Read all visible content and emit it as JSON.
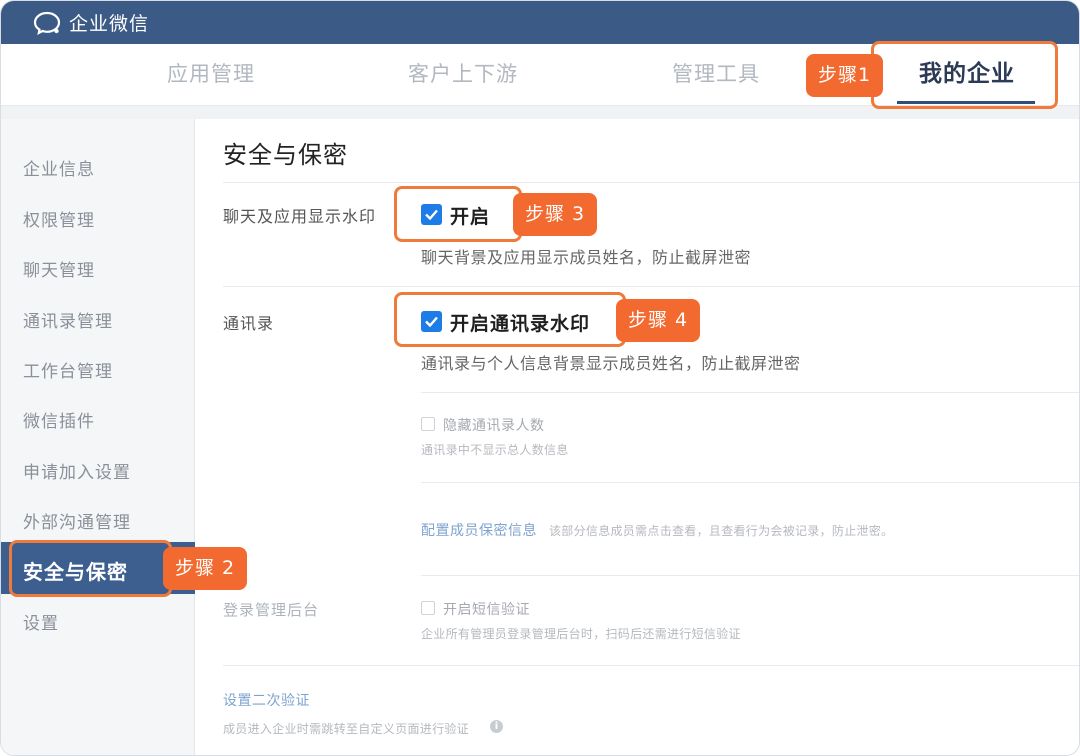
{
  "app": {
    "title": "企业微信",
    "logo_icon": "wecom-chat-bubble-icon"
  },
  "nav": {
    "tabs": [
      {
        "label": "应用管理"
      },
      {
        "label": "客户上下游"
      },
      {
        "label": "管理工具"
      },
      {
        "label": "我的企业"
      }
    ],
    "active_tab": "我的企业"
  },
  "sidebar": {
    "items": [
      {
        "label": "企业信息"
      },
      {
        "label": "权限管理"
      },
      {
        "label": "聊天管理"
      },
      {
        "label": "通讯录管理"
      },
      {
        "label": "工作台管理"
      },
      {
        "label": "微信插件"
      },
      {
        "label": "申请加入设置"
      },
      {
        "label": "外部沟通管理"
      },
      {
        "label": "安全与保密"
      },
      {
        "label": "设置"
      }
    ],
    "active_item": "安全与保密"
  },
  "main": {
    "title": "安全与保密",
    "chat_watermark": {
      "label": "聊天及应用显示水印",
      "checkbox_label": "开启",
      "checked": true,
      "description": "聊天背景及应用显示成员姓名，防止截屏泄密"
    },
    "contacts": {
      "label": "通讯录",
      "checkbox_label": "开启通讯录水印",
      "checked": true,
      "description": "通讯录与个人信息背景显示成员姓名，防止截屏泄密",
      "hide_count": {
        "label": "隐藏通讯录人数",
        "checked": false,
        "description": "通讯录中不显示总人数信息"
      },
      "privacy_link": "配置成员保密信息",
      "privacy_desc": "该部分信息成员需点击查看，且查看行为会被记录，防止泄密。"
    },
    "admin_login": {
      "label": "登录管理后台",
      "sms": {
        "label": "开启短信验证",
        "checked": false,
        "description": "企业所有管理员登录管理后台时，扫码后还需进行短信验证"
      }
    },
    "second_verify": {
      "link": "设置二次验证",
      "description": "成员进入企业时需跳转至自定义页面进行验证"
    }
  },
  "steps": {
    "step1": "步骤1",
    "step2": "步骤 2",
    "step3": "步骤 3",
    "step4": "步骤 4"
  },
  "colors": {
    "titlebar": "#3c5a86",
    "accent": "#f26a2f",
    "checkbox": "#1e7ce6",
    "active_sidebar": "#3d5f8f"
  }
}
